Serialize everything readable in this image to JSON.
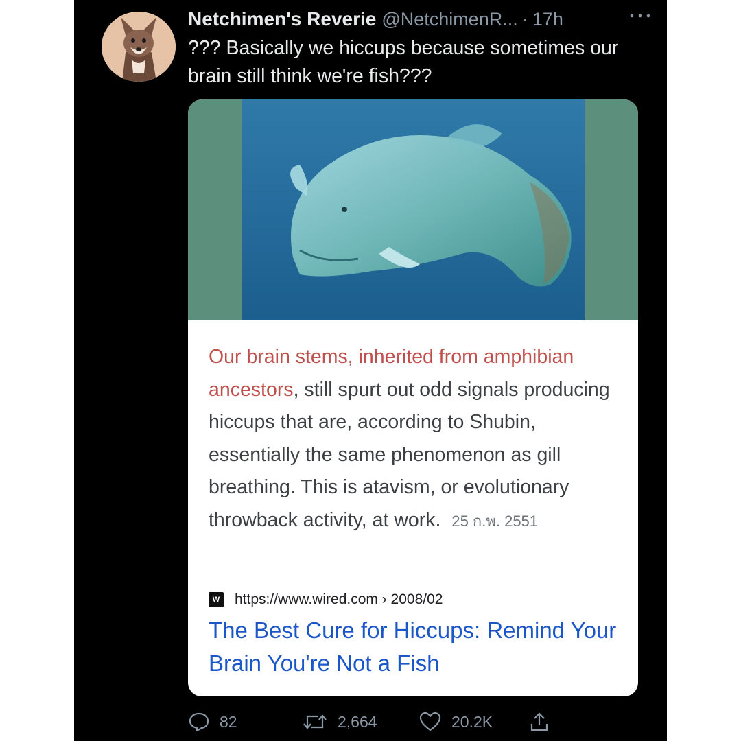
{
  "author": {
    "display_name": "Netchimen's Reverie",
    "handle": "@NetchimenR...",
    "separator": "·",
    "time": "17h"
  },
  "tweet": {
    "text": "??? Basically we hiccups because sometimes our brain still think we're fish???"
  },
  "card": {
    "snippet_highlight": "Our brain stems, inherited from amphibian ancestors",
    "snippet_rest": ", still spurt out odd signals producing hiccups that are, according to Shubin, essentially the same phenomenon as gill breathing. This is atavism, or evolutionary throwback activity, at work.",
    "snippet_date": "25 ก.พ. 2551",
    "favicon_text": "W",
    "source_url": "https://www.wired.com › 2008/02",
    "title": "The Best Cure for Hiccups: Remind Your Brain You're Not a Fish"
  },
  "actions": {
    "replies": "82",
    "retweets": "2,664",
    "likes": "20.2K"
  },
  "icons": {
    "more": "more-icon",
    "reply": "reply-icon",
    "retweet": "retweet-icon",
    "like": "like-icon",
    "share": "share-icon"
  },
  "colors": {
    "background": "#000000",
    "text": "#e7e9ea",
    "muted": "#8b98a5",
    "highlight": "#c0504d",
    "link": "#1a57c8"
  }
}
